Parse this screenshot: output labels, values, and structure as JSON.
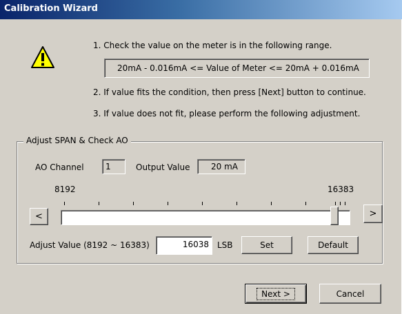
{
  "window": {
    "title": "Calibration Wizard"
  },
  "icon": {
    "name": "warning-icon",
    "color": "#ffff00"
  },
  "instructions": {
    "step1": "1. Check the value on the meter is in the following range.",
    "range": "20mA - 0.016mA <=  Value of Meter  <= 20mA + 0.016mA",
    "step2": "2. If value fits the condition, then press [Next] button to continue.",
    "step3": "3. If value does not fit, please perform the following adjustment."
  },
  "group": {
    "title": "Adjust SPAN & Check AO",
    "ao_channel_label": "AO Channel",
    "ao_channel_value": "1",
    "output_value_label": "Output Value",
    "output_value": "20 mA",
    "slider": {
      "min_label": "8192",
      "max_label": "16383",
      "min": 8192,
      "max": 16383,
      "value": 16038
    },
    "decrement_label": "<",
    "increment_label": ">",
    "adjust_label": "Adjust Value (8192 ~ 16383)",
    "adjust_value": "16038",
    "unit": "LSB",
    "set_label": "Set",
    "default_label": "Default"
  },
  "footer": {
    "next_label": "Next >",
    "cancel_label": "Cancel"
  }
}
